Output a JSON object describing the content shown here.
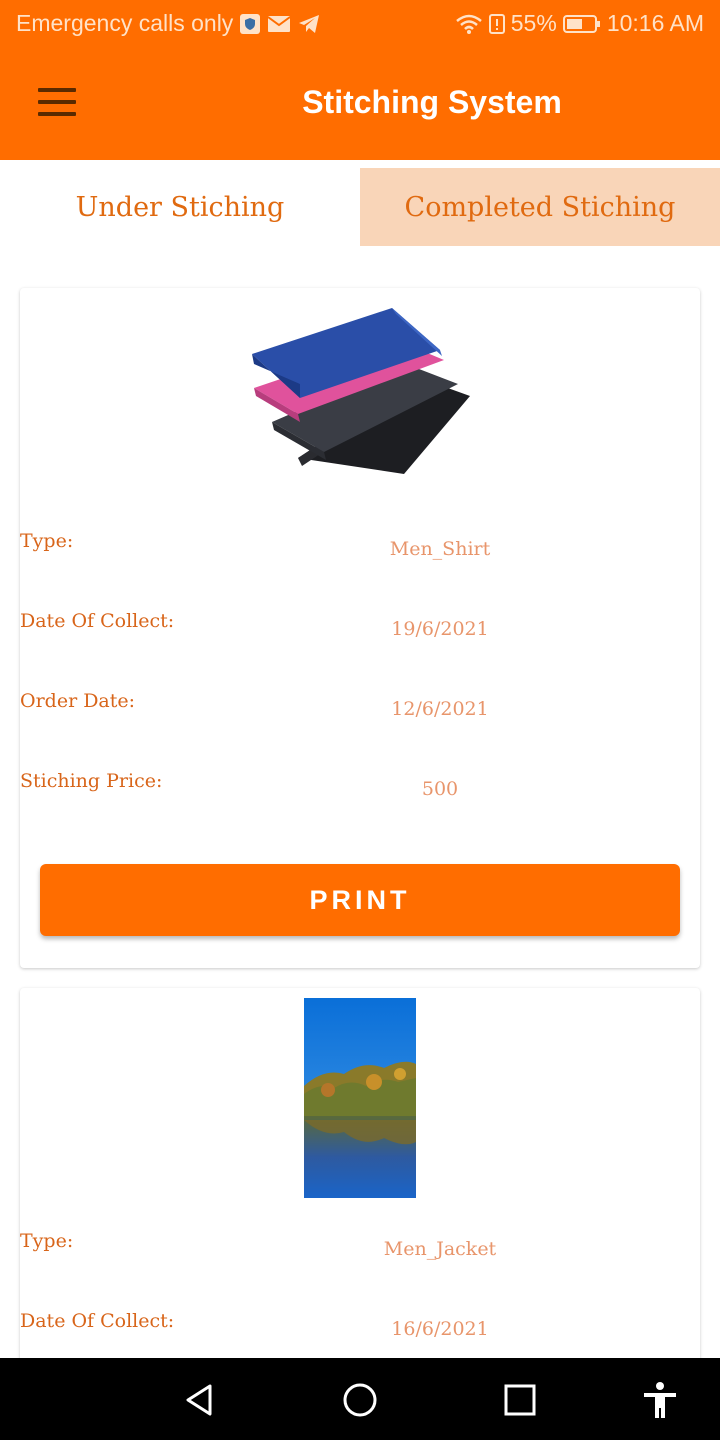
{
  "status_bar": {
    "carrier_text": "Emergency calls only",
    "battery_percent": "55%",
    "time": "10:16 AM",
    "icons": [
      "shield-icon",
      "mail-icon",
      "telegram-icon",
      "wifi-icon",
      "alert-icon",
      "battery-icon"
    ]
  },
  "app_bar": {
    "title": "Stitching System",
    "menu_icon": "hamburger-menu-icon"
  },
  "tabs": [
    {
      "label": "Under Stiching",
      "selected": true
    },
    {
      "label": "Completed Stiching",
      "selected": false
    }
  ],
  "orders": [
    {
      "image": "fabric-stack-image",
      "type_label": "Type:",
      "type_value": "Men_Shirt",
      "collect_label": "Date Of Collect:",
      "collect_value": "19/6/2021",
      "order_label": "Order Date:",
      "order_value": "12/6/2021",
      "price_label": "Stiching Price:",
      "price_value": "500",
      "print_label": "PRINT"
    },
    {
      "image": "lake-landscape-image",
      "type_label": "Type:",
      "type_value": "Men_Jacket",
      "collect_label": "Date Of Collect:",
      "collect_value": "16/6/2021"
    }
  ],
  "nav_bar": {
    "icons": [
      "back-icon",
      "home-icon",
      "recents-icon",
      "accessibility-icon"
    ]
  },
  "colors": {
    "primary": "#ff6d00",
    "tab_inactive_bg": "#f9d5b8",
    "label_text": "#d8651a",
    "value_text": "#e8956b"
  }
}
